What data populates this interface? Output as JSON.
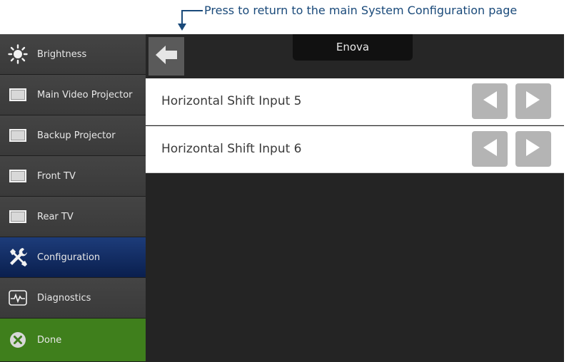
{
  "annotation": {
    "text": "Press to return to the main System Configuration page"
  },
  "sidebar": {
    "items": [
      {
        "label": "Brightness",
        "icon": "brightness-icon"
      },
      {
        "label": "Main Video Projector",
        "icon": "display-icon"
      },
      {
        "label": "Backup Projector",
        "icon": "display-icon"
      },
      {
        "label": "Front TV",
        "icon": "display-icon"
      },
      {
        "label": "Rear TV",
        "icon": "display-icon"
      },
      {
        "label": "Configuration",
        "icon": "tools-icon",
        "active": true
      },
      {
        "label": "Diagnostics",
        "icon": "waveform-icon"
      },
      {
        "label": "Done",
        "icon": "close-circle-icon"
      }
    ]
  },
  "header": {
    "title": "Enova",
    "back_icon": "back-arrow-icon"
  },
  "rows": [
    {
      "label": "Horizontal Shift Input 5"
    },
    {
      "label": "Horizontal Shift Input 6"
    }
  ],
  "colors": {
    "panel_bg": "#242424",
    "active_blue": "#0a1f4e",
    "done_green": "#3f7f1c",
    "callout": "#1a4a7a"
  }
}
